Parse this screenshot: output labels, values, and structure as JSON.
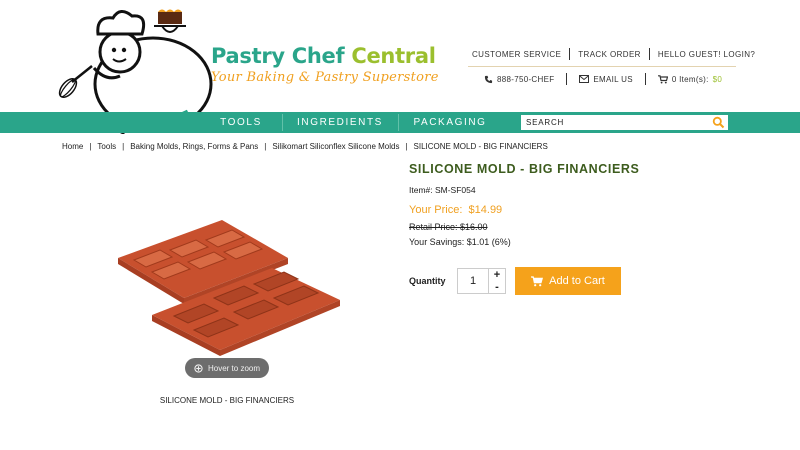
{
  "brand": {
    "name_part1": "Pastry Chef",
    "name_part2": "Central",
    "tagline": "Your Baking & Pastry Superstore"
  },
  "top_links": {
    "customer_service": "CUSTOMER SERVICE",
    "track_order": "TRACK ORDER",
    "login": "HELLO GUEST! LOGIN?"
  },
  "contact": {
    "phone": "888-750-CHEF",
    "email": "EMAIL US",
    "cart_items": "0 Item(s):",
    "cart_total": "$0"
  },
  "nav": {
    "items": [
      "TOOLS",
      "INGREDIENTS",
      "PACKAGING"
    ]
  },
  "search": {
    "placeholder": "SEARCH"
  },
  "breadcrumb": [
    "Home",
    "Tools",
    "Baking Molds, Rings, Forms & Pans",
    "Silikomart Siliconflex Silicone Molds",
    "SILICONE MOLD - BIG FINANCIERS"
  ],
  "product": {
    "title": "SILICONE MOLD - BIG FINANCIERS",
    "sku": "Item#: SM-SF054",
    "your_price_label": "Your Price:",
    "your_price": "$14.99",
    "retail_label": "Retail Price:",
    "retail_price": "$16.00",
    "savings": "Your Savings: $1.01 (6%)",
    "quantity_label": "Quantity",
    "quantity_value": "1",
    "add_to_cart": "Add to Cart",
    "zoom_hint": "Hover to zoom",
    "image_caption": "SILICONE MOLD - BIG FINANCIERS"
  },
  "colors": {
    "teal": "#2aa58a",
    "green": "#9bbf2e",
    "orange": "#f5a21b",
    "title_green": "#3d5c1e",
    "mold_red": "#c8502e"
  },
  "icons": {
    "phone": "phone-icon",
    "email": "email-icon",
    "cart": "cart-icon",
    "search": "search-icon",
    "zoom": "zoom-icon"
  }
}
